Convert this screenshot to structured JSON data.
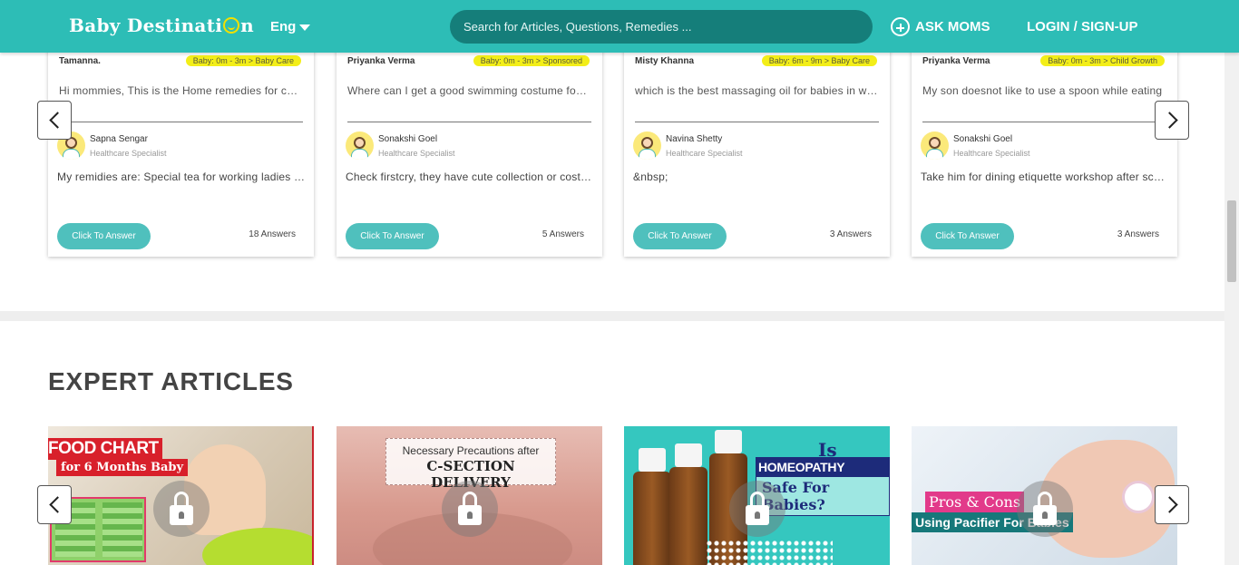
{
  "header": {
    "brand": "Baby Destinati",
    "brand_suffix": "n",
    "language": "Eng",
    "search_placeholder": "Search for Articles, Questions, Remedies ...",
    "ask_label": "ASK MOMS",
    "login_label": "LOGIN / SIGN-UP"
  },
  "questions": [
    {
      "asker": "Tamanna.",
      "tag": "Baby: 0m - 3m > Baby Care",
      "question": "Hi mommies, This is the Home remedies for cough and cold in babies",
      "expert": "Sapna Sengar",
      "role": "Healthcare Specialist",
      "answer": "My remidies are: Special tea for working ladies and kids",
      "button": "Click To Answer",
      "count": "18 Answers"
    },
    {
      "asker": "Priyanka Verma",
      "tag": "Baby: 0m - 3m > Sponsored",
      "question": "Where can I get a good swimming costume for my baby",
      "expert": "Sonakshi Goel",
      "role": "Healthcare Specialist",
      "answer": "Check firstcry, they have cute collection or costumes",
      "button": "Click To Answer",
      "count": "5 Answers"
    },
    {
      "asker": "Misty Khanna",
      "tag": "Baby: 6m - 9m > Baby Care",
      "question": "which is the best massaging oil for babies in winter",
      "expert": "Navina Shetty",
      "role": "Healthcare Specialist",
      "answer": "&nbsp;",
      "button": "Click To Answer",
      "count": "3 Answers"
    },
    {
      "asker": "Priyanka Verma",
      "tag": "Baby: 0m - 3m > Child Growth",
      "question": "My son doesnot like to use a spoon while eating",
      "expert": "Sonakshi Goel",
      "role": "Healthcare Specialist",
      "answer": "Take him for dining etiquette workshop after school",
      "button": "Click To Answer",
      "count": "3 Answers"
    }
  ],
  "articles_section": {
    "title": "EXPERT ARTICLES"
  },
  "articles": [
    {
      "line1": "FOOD CHART",
      "line2": "for 6 Months Baby"
    },
    {
      "line1": "Necessary Precautions after",
      "line2": "C-SECTION DELIVERY"
    },
    {
      "line1": "Is",
      "line2": "HOMEOPATHY MEDICINE",
      "line3": "Safe For Babies?"
    },
    {
      "line1": "Pros & Cons",
      "line2": "Using Pacifier For Babies"
    }
  ],
  "colors": {
    "brand_teal": "#2dbdb6",
    "tag_yellow": "#f3ee18",
    "answer_button": "#4fc0bd"
  },
  "icons": {
    "ask": "plus-circle-icon",
    "language": "chevron-down-icon",
    "prev": "chevron-left-icon",
    "next": "chevron-right-icon",
    "locked": "lock-icon"
  }
}
